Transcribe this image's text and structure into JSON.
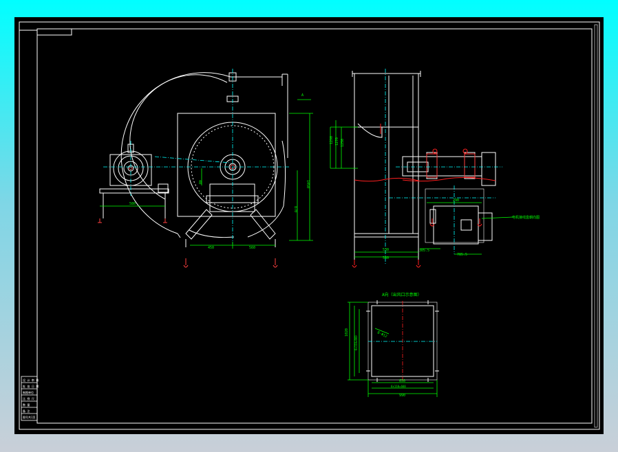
{
  "colors": {
    "sheet": "#000000",
    "frame": "#ffffff",
    "dimension": "#00ff00",
    "center_line": "#00ffff",
    "cut_line": "#ff2020",
    "hatch": "#ff4040",
    "window_bg_top": "#00ffff",
    "window_bg_bottom": "#c9cfd8"
  },
  "views": {
    "front_view": {
      "section_mark": "A",
      "dims": {
        "motor_base_width": "580",
        "outlet_left": "450",
        "outlet_right": "560",
        "height_total": "1450",
        "height_axis": "870",
        "hub_gap": "40"
      }
    },
    "side_view": {
      "dims": {
        "bottom_inner": "530",
        "bottom_outer": "560",
        "motor_offset": "290",
        "bracket_left": "305.5",
        "bracket_right": "785.5",
        "height_upper": "1290",
        "height_mid": "1270",
        "height_low": "1250"
      },
      "callout": "电机接线盒朝向图"
    },
    "outlet_view": {
      "title": "A向（出风口示意图）",
      "leader_label": "8-Φ12",
      "dims": {
        "inner_width": "650",
        "flange_width": "6x110=660",
        "outer_width": "990",
        "inner_height": "1020",
        "flange_height": "6x110=660"
      }
    }
  },
  "title_block": {
    "rows": [
      "设 计 审 核",
      "批 准 日 期",
      "制图单位",
      "比 例 尺",
      "数 量",
      "备 注",
      "图号共1页"
    ]
  }
}
